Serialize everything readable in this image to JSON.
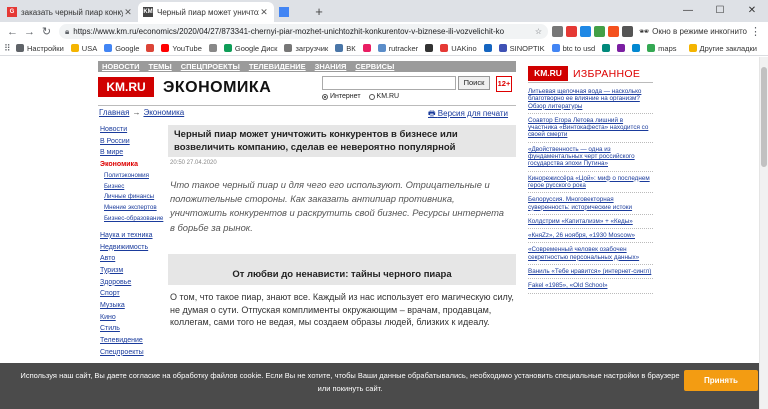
{
  "browser": {
    "tabs": [
      {
        "title": "заказать черный пиар конкуре",
        "active": false,
        "favicon_color": "#e53935",
        "favicon": "G"
      },
      {
        "title": "Черный пиар может уничтожить",
        "active": true,
        "favicon_color": "#444444",
        "favicon": "KM"
      },
      {
        "title": "",
        "active": false,
        "favicon_color": "#4285f4",
        "favicon": ""
      }
    ],
    "new_tab": "+",
    "url": "https://www.km.ru/economics/2020/04/27/873341-chernyi-piar-mozhet-unichtozhit-konkurentov-v-biznese-ili-vozvelichit-ko",
    "incognito_label": "Окно в режиме инкогнито",
    "bookmarks": [
      {
        "label": "Настройки",
        "color": "#5f6368"
      },
      {
        "label": "USA",
        "color": "#f4b400"
      },
      {
        "label": "Google",
        "color": "#4285f4"
      },
      {
        "label": "",
        "color": "#db4437"
      },
      {
        "label": "YouTube",
        "color": "#ff0000"
      },
      {
        "label": "",
        "color": "#888888"
      },
      {
        "label": "Google Диск",
        "color": "#0f9d58"
      },
      {
        "label": "загрузчик",
        "color": "#777777"
      },
      {
        "label": "ВК",
        "color": "#4a76a8"
      },
      {
        "label": "",
        "color": "#e91e63"
      },
      {
        "label": "rutracker",
        "color": "#5b8dc9"
      },
      {
        "label": "",
        "color": "#333333"
      },
      {
        "label": "UAKino",
        "color": "#e53935"
      },
      {
        "label": "",
        "color": "#1565c0"
      },
      {
        "label": "SINOPTIK",
        "color": "#3f51b5"
      },
      {
        "label": "btc to usd",
        "color": "#4285f4"
      },
      {
        "label": "",
        "color": "#00897b"
      },
      {
        "label": "",
        "color": "#7b1fa2"
      },
      {
        "label": "",
        "color": "#0288d1"
      },
      {
        "label": "maps",
        "color": "#34a853"
      }
    ],
    "other_bookmarks": "Другие закладки"
  },
  "site": {
    "top_menu": [
      "НОВОСТИ",
      "ТЕМЫ",
      "СПЕЦПРОЕКТЫ",
      "ТЕЛЕВИДЕНИЕ",
      "ЗНАНИЯ",
      "СЕРВИСЫ"
    ],
    "logo": "KM.RU",
    "section_title": "ЭКОНОМИКА",
    "search_button": "Поиск",
    "radio_internet": "Интернет",
    "radio_kmru": "KM.RU",
    "age_badge": "12+",
    "breadcrumb_home": "Главная",
    "breadcrumb_arrow": "→",
    "breadcrumb_section": "Экономика",
    "print_version": "Версия для печати",
    "left_nav": [
      {
        "label": "Новости",
        "cls": ""
      },
      {
        "label": "В России",
        "cls": ""
      },
      {
        "label": "В мире",
        "cls": ""
      },
      {
        "label": "Экономика",
        "cls": "cur"
      },
      {
        "label": "Политэкономия",
        "cls": "sub"
      },
      {
        "label": "Бизнес",
        "cls": "sub"
      },
      {
        "label": "Личные финансы",
        "cls": "sub"
      },
      {
        "label": "Мнение экспертов",
        "cls": "sub"
      },
      {
        "label": "Бизнес-образование",
        "cls": "sub"
      },
      {
        "label": "Наука и техника",
        "cls": "gap"
      },
      {
        "label": "Недвижимость",
        "cls": ""
      },
      {
        "label": "Авто",
        "cls": ""
      },
      {
        "label": "Туризм",
        "cls": ""
      },
      {
        "label": "Здоровье",
        "cls": ""
      },
      {
        "label": "Спорт",
        "cls": ""
      },
      {
        "label": "Музыка",
        "cls": ""
      },
      {
        "label": "Кино",
        "cls": ""
      },
      {
        "label": "Стиль",
        "cls": ""
      },
      {
        "label": "Телевидение",
        "cls": ""
      },
      {
        "label": "Спецпроекты",
        "cls": ""
      }
    ],
    "article": {
      "title": "Черный пиар может уничтожить конкурентов в бизнесе или возвеличить компанию, сделав ее невероятно популярной",
      "date": "20:50 27.04.2020",
      "lead": "Что такое черный пиар и для чего его используют. Отрицательные и положительные стороны. Как заказать антипиар противника, уничтожить конкурентов и раскрутить свой бизнес. Ресурсы интернета в борьбе за рынок.",
      "subheading": "От любви до ненависти: тайны черного пиара",
      "paragraph": "О том, что такое пиар, знают все. Каждый из нас использует его магическую силу, не думая о сути. Отпуская комплименты окружающим – врачам, продавцам, коллегам, сами того не ведая, мы создаем образы людей, близких к идеалу."
    },
    "right_col": {
      "logo": "KM.RU",
      "title": "ИЗБРАННОЕ",
      "items": [
        "Литьевая щелочная вода — насколько благотворно ее влияние на организм? Обзор литературы",
        "Соавтор Егора Летова лишний в участника «Винтокафеста» находится со своей смерти",
        "«Двойственность — одна из фундаментальных черт российского государства эпохи Путина»",
        "Кинорежиссёра «Цой»: миф о последнем герое русского рока",
        "Белоруссия. Многовекторная суверенность: исторические истоки",
        "Колдстрим «Капитализм» + «Кеды»",
        "«КняZz», 26 ноября, «1930 Moscow»",
        "«Современный человек озабочен секретностью персональных данных»",
        "Ваниль «Тебе нравится» (интернет-сингл)",
        "Fakel «1985», «Old School»"
      ]
    },
    "cookie_text": "Используя наш сайт, Вы даете согласие на обработку файлов cookie. Если Вы не хотите, чтобы Ваши данные обрабатывались, необходимо установить специальные настройки в браузере или покинуть сайт.",
    "cookie_button": "Принять"
  }
}
